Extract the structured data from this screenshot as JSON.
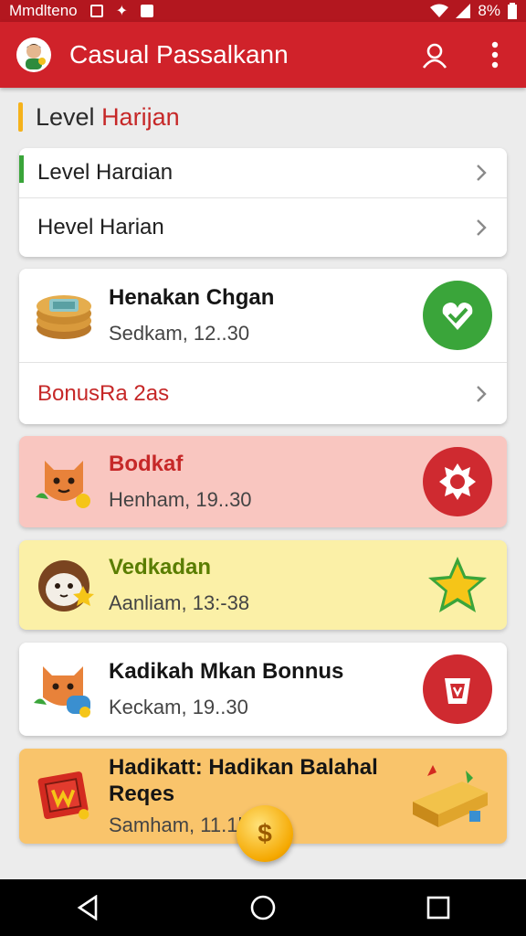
{
  "status_bar": {
    "carrier": "Mmdlteno",
    "battery": "8%"
  },
  "app_bar": {
    "title": "Casual Passalkann"
  },
  "section": {
    "title_main": "Level ",
    "title_accent": "Harijan"
  },
  "level_list": [
    {
      "label": "Level Harɑian"
    },
    {
      "label": "Hevel Harian"
    }
  ],
  "challenge_card": {
    "title": "Henakan Chgan",
    "subtitle": "Sedkam, 12..30",
    "bonus_label": "BonusRa 2as"
  },
  "items": [
    {
      "title": "Bodkaf",
      "subtitle": "Henham, 19..30",
      "title_color": "#c62828",
      "bg": "#f9c6c0"
    },
    {
      "title": "Vedkadan",
      "subtitle": "Aanliam, 13:-38",
      "title_color": "#5a7d00",
      "bg": "#fbf0a7"
    },
    {
      "title": "Kadikah Mkan Bonnus",
      "subtitle": "Keckam, 19..30",
      "title_color": "#151515",
      "bg": "#ffffff"
    },
    {
      "title": "Hadikatt: Hadikan Balahal Reqes",
      "subtitle": "Samham, 11.1l 088",
      "title_color": "#151515",
      "bg": "#f9c46b"
    }
  ],
  "colors": {
    "primary": "#d0222a",
    "status": "#b3171f",
    "green": "#3aa53a",
    "yellow_accent": "#f5b21b"
  }
}
